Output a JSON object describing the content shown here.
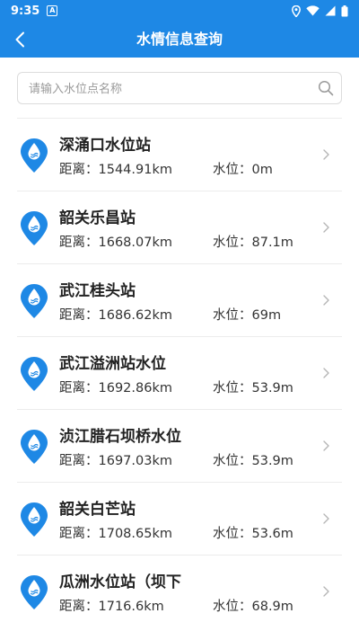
{
  "status_bar": {
    "time": "9:35",
    "notification_icon": "a-notification-icon",
    "icons": [
      "location-icon",
      "wifi-icon",
      "signal-icon",
      "battery-icon"
    ]
  },
  "app_bar": {
    "title": "水情信息查询",
    "back_icon": "chevron-left-icon",
    "background_color": "#1e88e5"
  },
  "search": {
    "placeholder": "请输入水位点名称",
    "value": "",
    "icon": "search-icon"
  },
  "stations": [
    {
      "name": "深涌口水位站",
      "distance": "距离：1544.91km",
      "level": "水位：0m"
    },
    {
      "name": "韶关乐昌站",
      "distance": "距离：1668.07km",
      "level": "水位：87.1m"
    },
    {
      "name": "武江桂头站",
      "distance": "距离：1686.62km",
      "level": "水位：69m"
    },
    {
      "name": "武江溢洲站水位",
      "distance": "距离：1692.86km",
      "level": "水位：53.9m"
    },
    {
      "name": "浈江腊石坝桥水位",
      "distance": "距离：1697.03km",
      "level": "水位：53.9m"
    },
    {
      "name": "韶关白芒站",
      "distance": "距离：1708.65km",
      "level": "水位：53.6m"
    },
    {
      "name": "瓜洲水位站（坝下",
      "distance": "距离：1716.6km",
      "level": "水位：68.9m"
    }
  ],
  "colors": {
    "accent": "#1e88e5",
    "divider": "#ececec",
    "chevron": "#b5b5b5"
  }
}
